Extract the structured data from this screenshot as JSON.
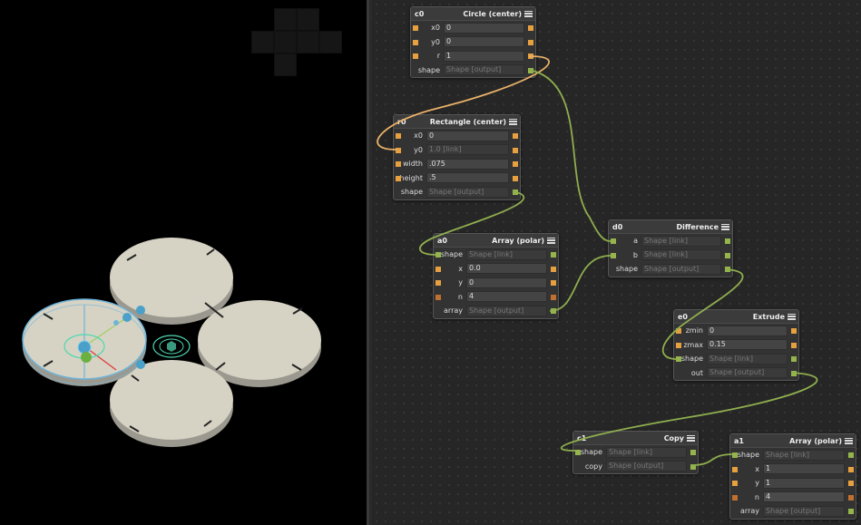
{
  "colors": {
    "number_port": "#e6a040",
    "shape_port": "#95b54c",
    "int_port": "#c07030",
    "wire_orange": "#e9b168",
    "wire_green": "#8fae4e",
    "disc": "#d6d3c5",
    "gizmo": "#6fb4d8"
  },
  "nodes": {
    "c0": {
      "id": "c0",
      "title": "Circle (center)",
      "rows": [
        {
          "label": "x0",
          "value": "0"
        },
        {
          "label": "y0",
          "value": "0"
        },
        {
          "label": "r",
          "value": "1"
        },
        {
          "label": "shape",
          "value": "Shape [output]"
        }
      ]
    },
    "r0": {
      "id": "r0",
      "title": "Rectangle (center)",
      "rows": [
        {
          "label": "x0",
          "value": "0"
        },
        {
          "label": "y0",
          "value": "1.0 [link]"
        },
        {
          "label": "width",
          "value": ".075"
        },
        {
          "label": "height",
          "value": ".5"
        },
        {
          "label": "shape",
          "value": "Shape [output]"
        }
      ]
    },
    "a0": {
      "id": "a0",
      "title": "Array (polar)",
      "rows": [
        {
          "label": "shape",
          "value": "Shape [link]"
        },
        {
          "label": "x",
          "value": "0.0"
        },
        {
          "label": "y",
          "value": "0"
        },
        {
          "label": "n",
          "value": "4"
        },
        {
          "label": "array",
          "value": "Shape [output]"
        }
      ]
    },
    "d0": {
      "id": "d0",
      "title": "Difference",
      "rows": [
        {
          "label": "a",
          "value": "Shape [link]"
        },
        {
          "label": "b",
          "value": "Shape [link]"
        },
        {
          "label": "shape",
          "value": "Shape [output]"
        }
      ]
    },
    "e0": {
      "id": "e0",
      "title": "Extrude",
      "rows": [
        {
          "label": "zmin",
          "value": "0"
        },
        {
          "label": "zmax",
          "value": "0.15"
        },
        {
          "label": "shape",
          "value": "Shape [link]"
        },
        {
          "label": "out",
          "value": "Shape [output]"
        }
      ]
    },
    "c1": {
      "id": "c1",
      "title": "Copy",
      "rows": [
        {
          "label": "shape",
          "value": "Shape [link]"
        },
        {
          "label": "copy",
          "value": "Shape [output]"
        }
      ]
    },
    "a1": {
      "id": "a1",
      "title": "Array (polar)",
      "rows": [
        {
          "label": "shape",
          "value": "Shape [link]"
        },
        {
          "label": "x",
          "value": "1"
        },
        {
          "label": "y",
          "value": "1"
        },
        {
          "label": "n",
          "value": "4"
        },
        {
          "label": "array",
          "value": "Shape [output]"
        }
      ]
    }
  }
}
